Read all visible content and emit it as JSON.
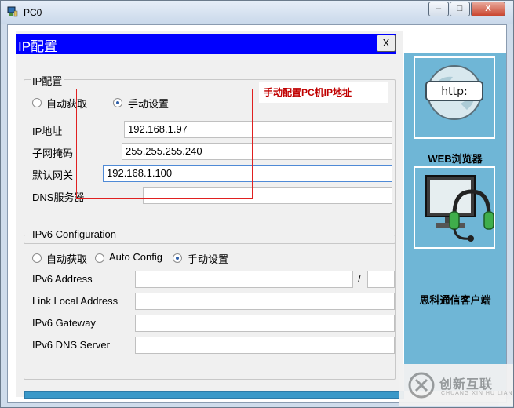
{
  "window": {
    "title": "PC0",
    "minimize": "–",
    "maximize": "□",
    "close": "X"
  },
  "header": {
    "title": "IP配置",
    "close": "X"
  },
  "ipv4": {
    "legend": "IP配置",
    "dhcp_label": "自动获取",
    "static_label": "手动设置",
    "selected": "static",
    "ip_label": "IP地址",
    "ip_value": "192.168.1.97",
    "mask_label": "子网掩码",
    "mask_value": "255.255.255.240",
    "gateway_label": "默认网关",
    "gateway_value": "192.168.1.100",
    "dns_label": "DNS服务器",
    "dns_value": ""
  },
  "annotation": "手动配置PC机IP地址",
  "ipv6": {
    "legend": "IPv6 Configuration",
    "auto_label": "自动获取",
    "autoconfig_label": "Auto Config",
    "static_label": "手动设置",
    "selected": "static",
    "address_label": "IPv6 Address",
    "address_value": "",
    "prefix_sep": "/",
    "prefix_value": "",
    "link_local_label": "Link Local Address",
    "link_local_value": "",
    "gateway_label": "IPv6 Gateway",
    "gateway_value": "",
    "dns_label": "IPv6 DNS Server",
    "dns_value": ""
  },
  "sidebar": {
    "browser_label": "WEB浏览器",
    "browser_icon_text": "http:",
    "client_label": "思科通信客户端"
  },
  "watermark": {
    "text": "创新互联",
    "sub": "CHUANG XIN HU LIAN"
  },
  "colors": {
    "header": "#0000ff",
    "sidebar": "#6fb6d6",
    "annotation": "#c00000",
    "highlight_box": "#e02020"
  }
}
